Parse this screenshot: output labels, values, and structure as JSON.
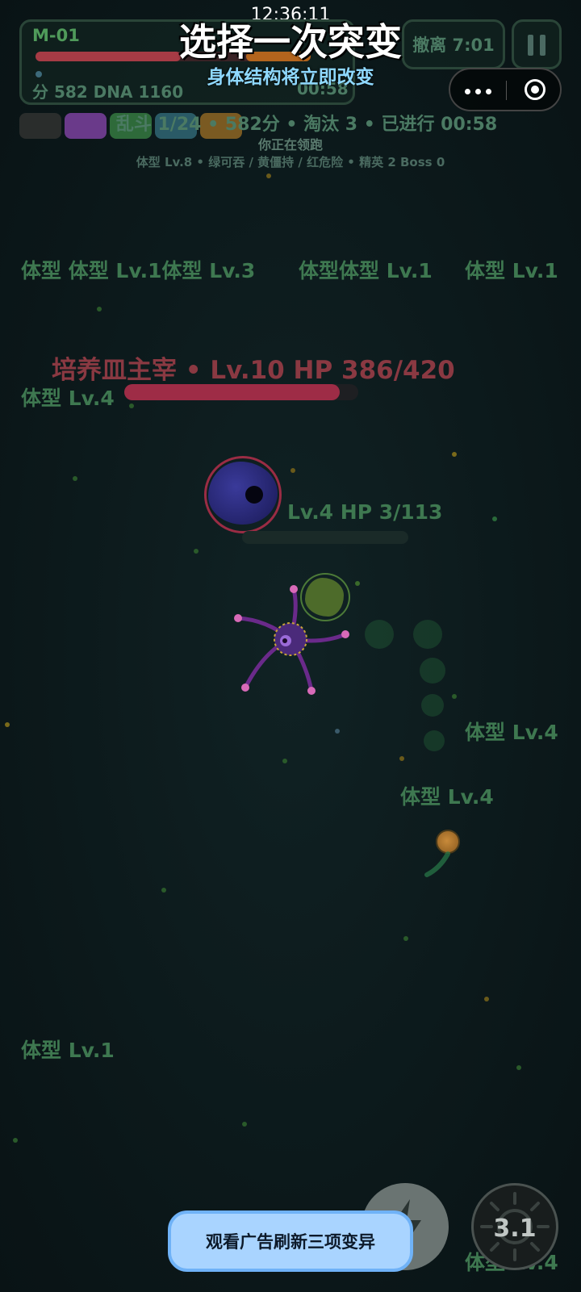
{
  "status_bar": {
    "time": "12:36:11"
  },
  "hud": {
    "map_id": "M-01",
    "stats": "分 582  DNA 1160",
    "timer": "00:58",
    "retreat_label": "撤离 7:01",
    "hp_fraction": 0.53
  },
  "overlay": {
    "title": "选择一次突变",
    "subtitle": "身体结构将立即改变"
  },
  "match": {
    "info": "乱斗 1/24  •  582分  •  淘汰 3  •  已进行 00:58",
    "lead_status": "你正在领跑",
    "details": "体型 Lv.8 • 绿可吞 / 黄僵持 / 红危险 • 精英 2 Boss 0"
  },
  "chip_colors": [
    "#2a2d2c",
    "#6a3a8a",
    "#2e6a3a",
    "#2a5a66",
    "#7a5a22"
  ],
  "enemy_labels": [
    "体型 体型 Lv.1体型 Lv.3",
    "体型体型 Lv.1",
    "体型 Lv.1",
    "体型 Lv.4",
    "体型 Lv.4",
    "体型 Lv.4",
    "体型 Lv.1",
    "体型 Lv.4"
  ],
  "boss": {
    "label": "培养皿主宰 • Lv.10 HP 386/420",
    "hp_fraction": 0.919
  },
  "nearby_enemy": {
    "label": "Lv.4 HP 3/113",
    "hp_fraction": 0.027
  },
  "controls": {
    "ad_refresh_label": "观看广告刷新三项变异",
    "skill_cooldown": "3.1",
    "skill1_icon": "lightning-icon",
    "skill2_icon": "sun-icon"
  },
  "colors": {
    "label_green": "#3e7850",
    "boss_red": "#8a3942",
    "accent_blue": "#6fb2f7"
  }
}
